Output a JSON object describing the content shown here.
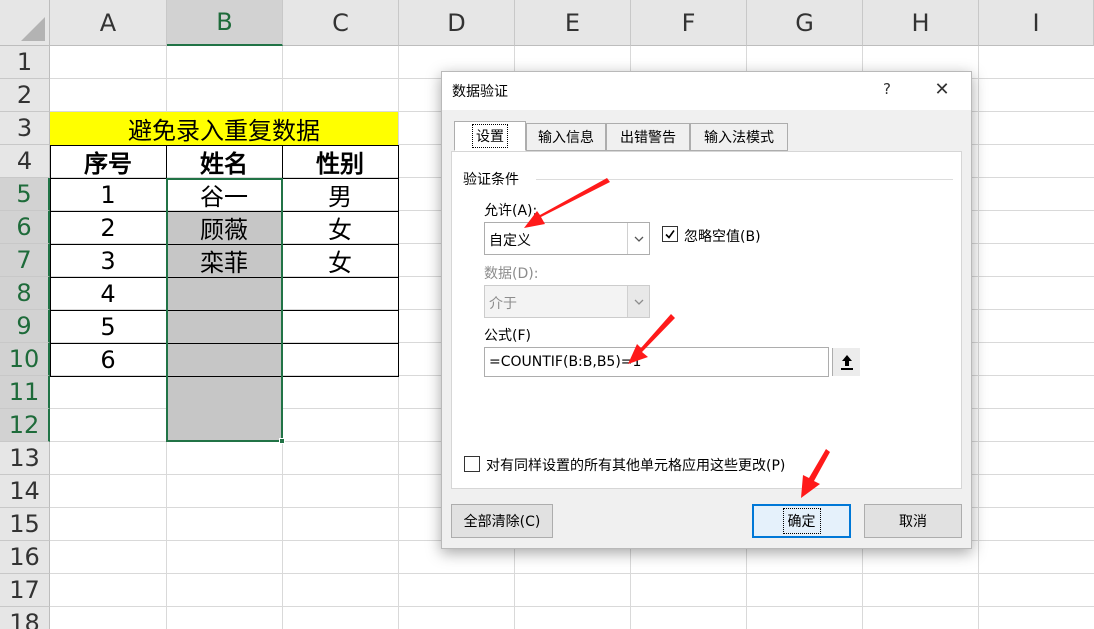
{
  "sheet": {
    "columns": [
      "A",
      "B",
      "C",
      "D",
      "E",
      "F",
      "G",
      "H",
      "I"
    ],
    "rows": [
      "1",
      "2",
      "3",
      "4",
      "5",
      "6",
      "7",
      "8",
      "9",
      "10",
      "11",
      "12",
      "13",
      "14",
      "15",
      "16",
      "17",
      "18"
    ],
    "selected_column": "B",
    "table": {
      "title": "避免录入重复数据",
      "title_fill": "#ffff00",
      "headers": [
        "序号",
        "姓名",
        "性别"
      ],
      "rows": [
        [
          "1",
          "谷一",
          "男"
        ],
        [
          "2",
          "顾薇",
          "女"
        ],
        [
          "3",
          "栾菲",
          "女"
        ],
        [
          "4",
          "",
          ""
        ],
        [
          "5",
          "",
          ""
        ],
        [
          "6",
          "",
          ""
        ]
      ]
    },
    "selection_color": "#217346"
  },
  "dialog": {
    "title": "数据验证",
    "help_glyph": "?",
    "close_glyph": "✕",
    "tabs": [
      {
        "label": "设置",
        "active": true
      },
      {
        "label": "输入信息",
        "active": false
      },
      {
        "label": "出错警告",
        "active": false
      },
      {
        "label": "输入法模式",
        "active": false
      }
    ],
    "group_label": "验证条件",
    "allow_label": "允许(A):",
    "allow_value": "自定义",
    "ignore_blank_label": "忽略空值(B)",
    "ignore_blank_checked": true,
    "data_label": "数据(D):",
    "data_value": "介于",
    "formula_label": "公式(F)",
    "formula_value": "=COUNTIF(B:B,B5)=1",
    "apply_all_label": "对有同样设置的所有其他单元格应用这些更改(P)",
    "apply_all_checked": false,
    "clear_all_label": "全部清除(C)",
    "ok_label": "确定",
    "cancel_label": "取消"
  },
  "annotation_color": "#ff1a1a"
}
